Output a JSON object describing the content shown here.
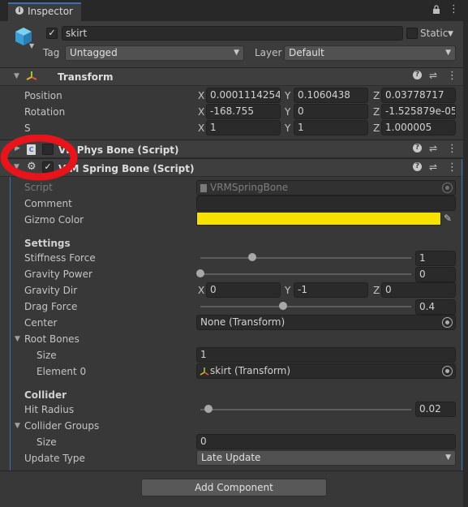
{
  "tab": {
    "title": "Inspector",
    "info_icon": "info-icon",
    "lock_icon": "lock-icon",
    "menu_icon": "kebab-menu-icon"
  },
  "object": {
    "active_checked": true,
    "name": "skirt",
    "static_label": "Static",
    "static_checked": false,
    "tag_label": "Tag",
    "tag_value": "Untagged",
    "layer_label": "Layer",
    "layer_value": "Default"
  },
  "transform": {
    "title": "Transform",
    "position_label": "Position",
    "rotation_label": "Rotation",
    "scale_label": "S",
    "position": {
      "x": "0.0001114254",
      "y": "0.1060438",
      "z": "0.03778717"
    },
    "rotation": {
      "x": "-168.755",
      "y": "0",
      "z": "-1.525879e-05"
    },
    "scale": {
      "x": "1",
      "y": "1",
      "z": "1.000005"
    },
    "x": "X",
    "y": "Y",
    "z": "Z"
  },
  "phys_bone": {
    "title": "VR  Phys Bone (Script)",
    "enabled": false
  },
  "spring_bone": {
    "title": "V  M Spring Bone (Script)",
    "enabled": true,
    "script_label": "Script",
    "script_value": "VRMSpringBone",
    "comment_label": "Comment",
    "comment_value": "",
    "gizmo_label": "Gizmo Color",
    "gizmo_color": "#f7e100",
    "settings_label": "Settings",
    "stiffness_label": "Stiffness Force",
    "stiffness_value": "1",
    "stiffness_fraction": 0.26,
    "gravity_power_label": "Gravity Power",
    "gravity_power_value": "0",
    "gravity_power_fraction": 0.0,
    "gravity_dir_label": "Gravity Dir",
    "gravity_dir": {
      "x": "0",
      "y": "-1",
      "z": "0"
    },
    "drag_label": "Drag Force",
    "drag_value": "0.4",
    "drag_fraction": 0.4,
    "center_label": "Center",
    "center_value": "None (Transform)",
    "root_bones_label": "Root Bones",
    "size_label": "Size",
    "root_bones_size": "1",
    "element0_label": "Element 0",
    "element0_value": "skirt (Transform)",
    "collider_label": "Collider",
    "hit_radius_label": "Hit Radius",
    "hit_radius_value": "0.02",
    "hit_radius_fraction": 0.04,
    "collider_groups_label": "Collider Groups",
    "collider_groups_size": "0",
    "update_type_label": "Update Type",
    "update_type_value": "Late Update"
  },
  "add_component": "Add Component",
  "annotation": {
    "shape": "red-circle",
    "color": "#e8141b"
  }
}
